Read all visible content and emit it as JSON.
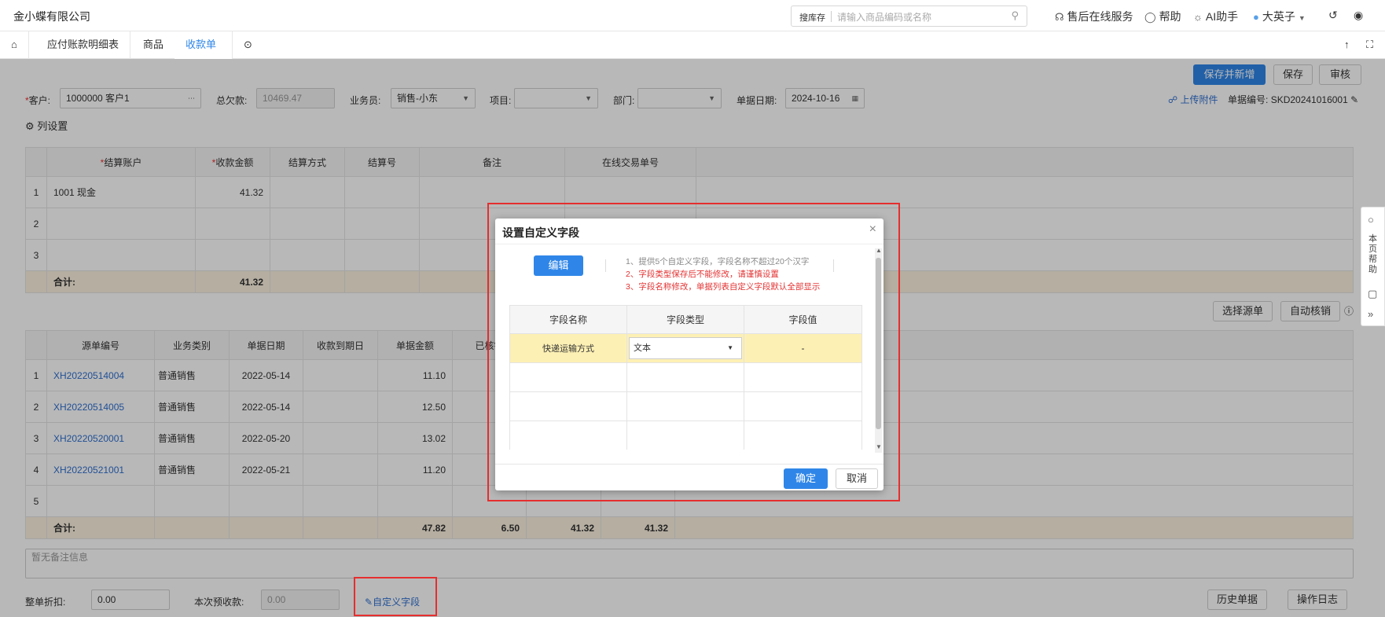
{
  "header": {
    "company": "金小蝶有限公司",
    "search_scope": "搜库存",
    "search_placeholder": "请输入商品编码或名称",
    "nav": {
      "service": "售后在线服务",
      "help": "帮助",
      "ai": "AI助手",
      "user": "大英子"
    }
  },
  "tabs": [
    "应付账款明细表",
    "商品",
    "收款单"
  ],
  "toolbar": {
    "save_new": "保存并新增",
    "save": "保存",
    "audit": "审核"
  },
  "form": {
    "customer_label": "客户:",
    "customer_value": "1000000 客户1",
    "total_debt_label": "总欠款:",
    "total_debt_value": "10469.47",
    "salesman_label": "业务员:",
    "salesman_value": "销售-小东",
    "project_label": "项目:",
    "dept_label": "部门:",
    "date_label": "单据日期:",
    "date_value": "2024-10-16",
    "attach": "上传附件",
    "docno_label": "单据编号:",
    "docno_value": "SKD20241016001"
  },
  "column_settings": "列设置",
  "settle_table": {
    "headers": [
      "结算账户",
      "收款金额",
      "结算方式",
      "结算号",
      "备注",
      "在线交易单号"
    ],
    "rows": [
      {
        "idx": "1",
        "account": "1001 现金",
        "amount": "41.32"
      },
      {
        "idx": "2",
        "account": "",
        "amount": ""
      },
      {
        "idx": "3",
        "account": "",
        "amount": ""
      }
    ],
    "sum_label": "合计:",
    "sum_amount": "41.32"
  },
  "source_buttons": {
    "select_source": "选择源单",
    "auto_verify": "自动核销"
  },
  "source_table": {
    "headers": [
      "源单编号",
      "业务类别",
      "单据日期",
      "收款到期日",
      "单据金额",
      "已核销"
    ],
    "rows": [
      {
        "idx": "1",
        "no": "XH20220514004",
        "type": "普通销售",
        "date": "2022-05-14",
        "amount": "11.10"
      },
      {
        "idx": "2",
        "no": "XH20220514005",
        "type": "普通销售",
        "date": "2022-05-14",
        "amount": "12.50"
      },
      {
        "idx": "3",
        "no": "XH20220520001",
        "type": "普通销售",
        "date": "2022-05-20",
        "amount": "13.02"
      },
      {
        "idx": "4",
        "no": "XH20220521001",
        "type": "普通销售",
        "date": "2022-05-21",
        "amount": "11.20"
      },
      {
        "idx": "5",
        "no": "",
        "type": "",
        "date": "",
        "amount": ""
      }
    ],
    "sum_label": "合计:",
    "sum_values": [
      "47.82",
      "6.50",
      "41.32",
      "41.32"
    ]
  },
  "remark_placeholder": "暂无备注信息",
  "footer": {
    "discount_label": "整单折扣:",
    "discount_value": "0.00",
    "prepay_label": "本次预收款:",
    "prepay_value": "0.00",
    "custom_field": "自定义字段",
    "history": "历史单据",
    "log": "操作日志"
  },
  "helper": {
    "text": "本页帮助"
  },
  "dialog": {
    "title": "设置自定义字段",
    "edit": "编辑",
    "notes": [
      "1、提供5个自定义字段，字段名称不超过20个汉字",
      "2、字段类型保存后不能修改，请谨慎设置",
      "3、字段名称修改，单据列表自定义字段默认全部显示"
    ],
    "headers": [
      "字段名称",
      "字段类型",
      "字段值"
    ],
    "row": {
      "name": "快递运输方式",
      "type": "文本",
      "value": "-"
    },
    "ok": "确定",
    "cancel": "取消",
    "colors": {
      "primary": "#2f86e8",
      "warn": "#e33333",
      "highlight": "#fdf0b4"
    }
  }
}
